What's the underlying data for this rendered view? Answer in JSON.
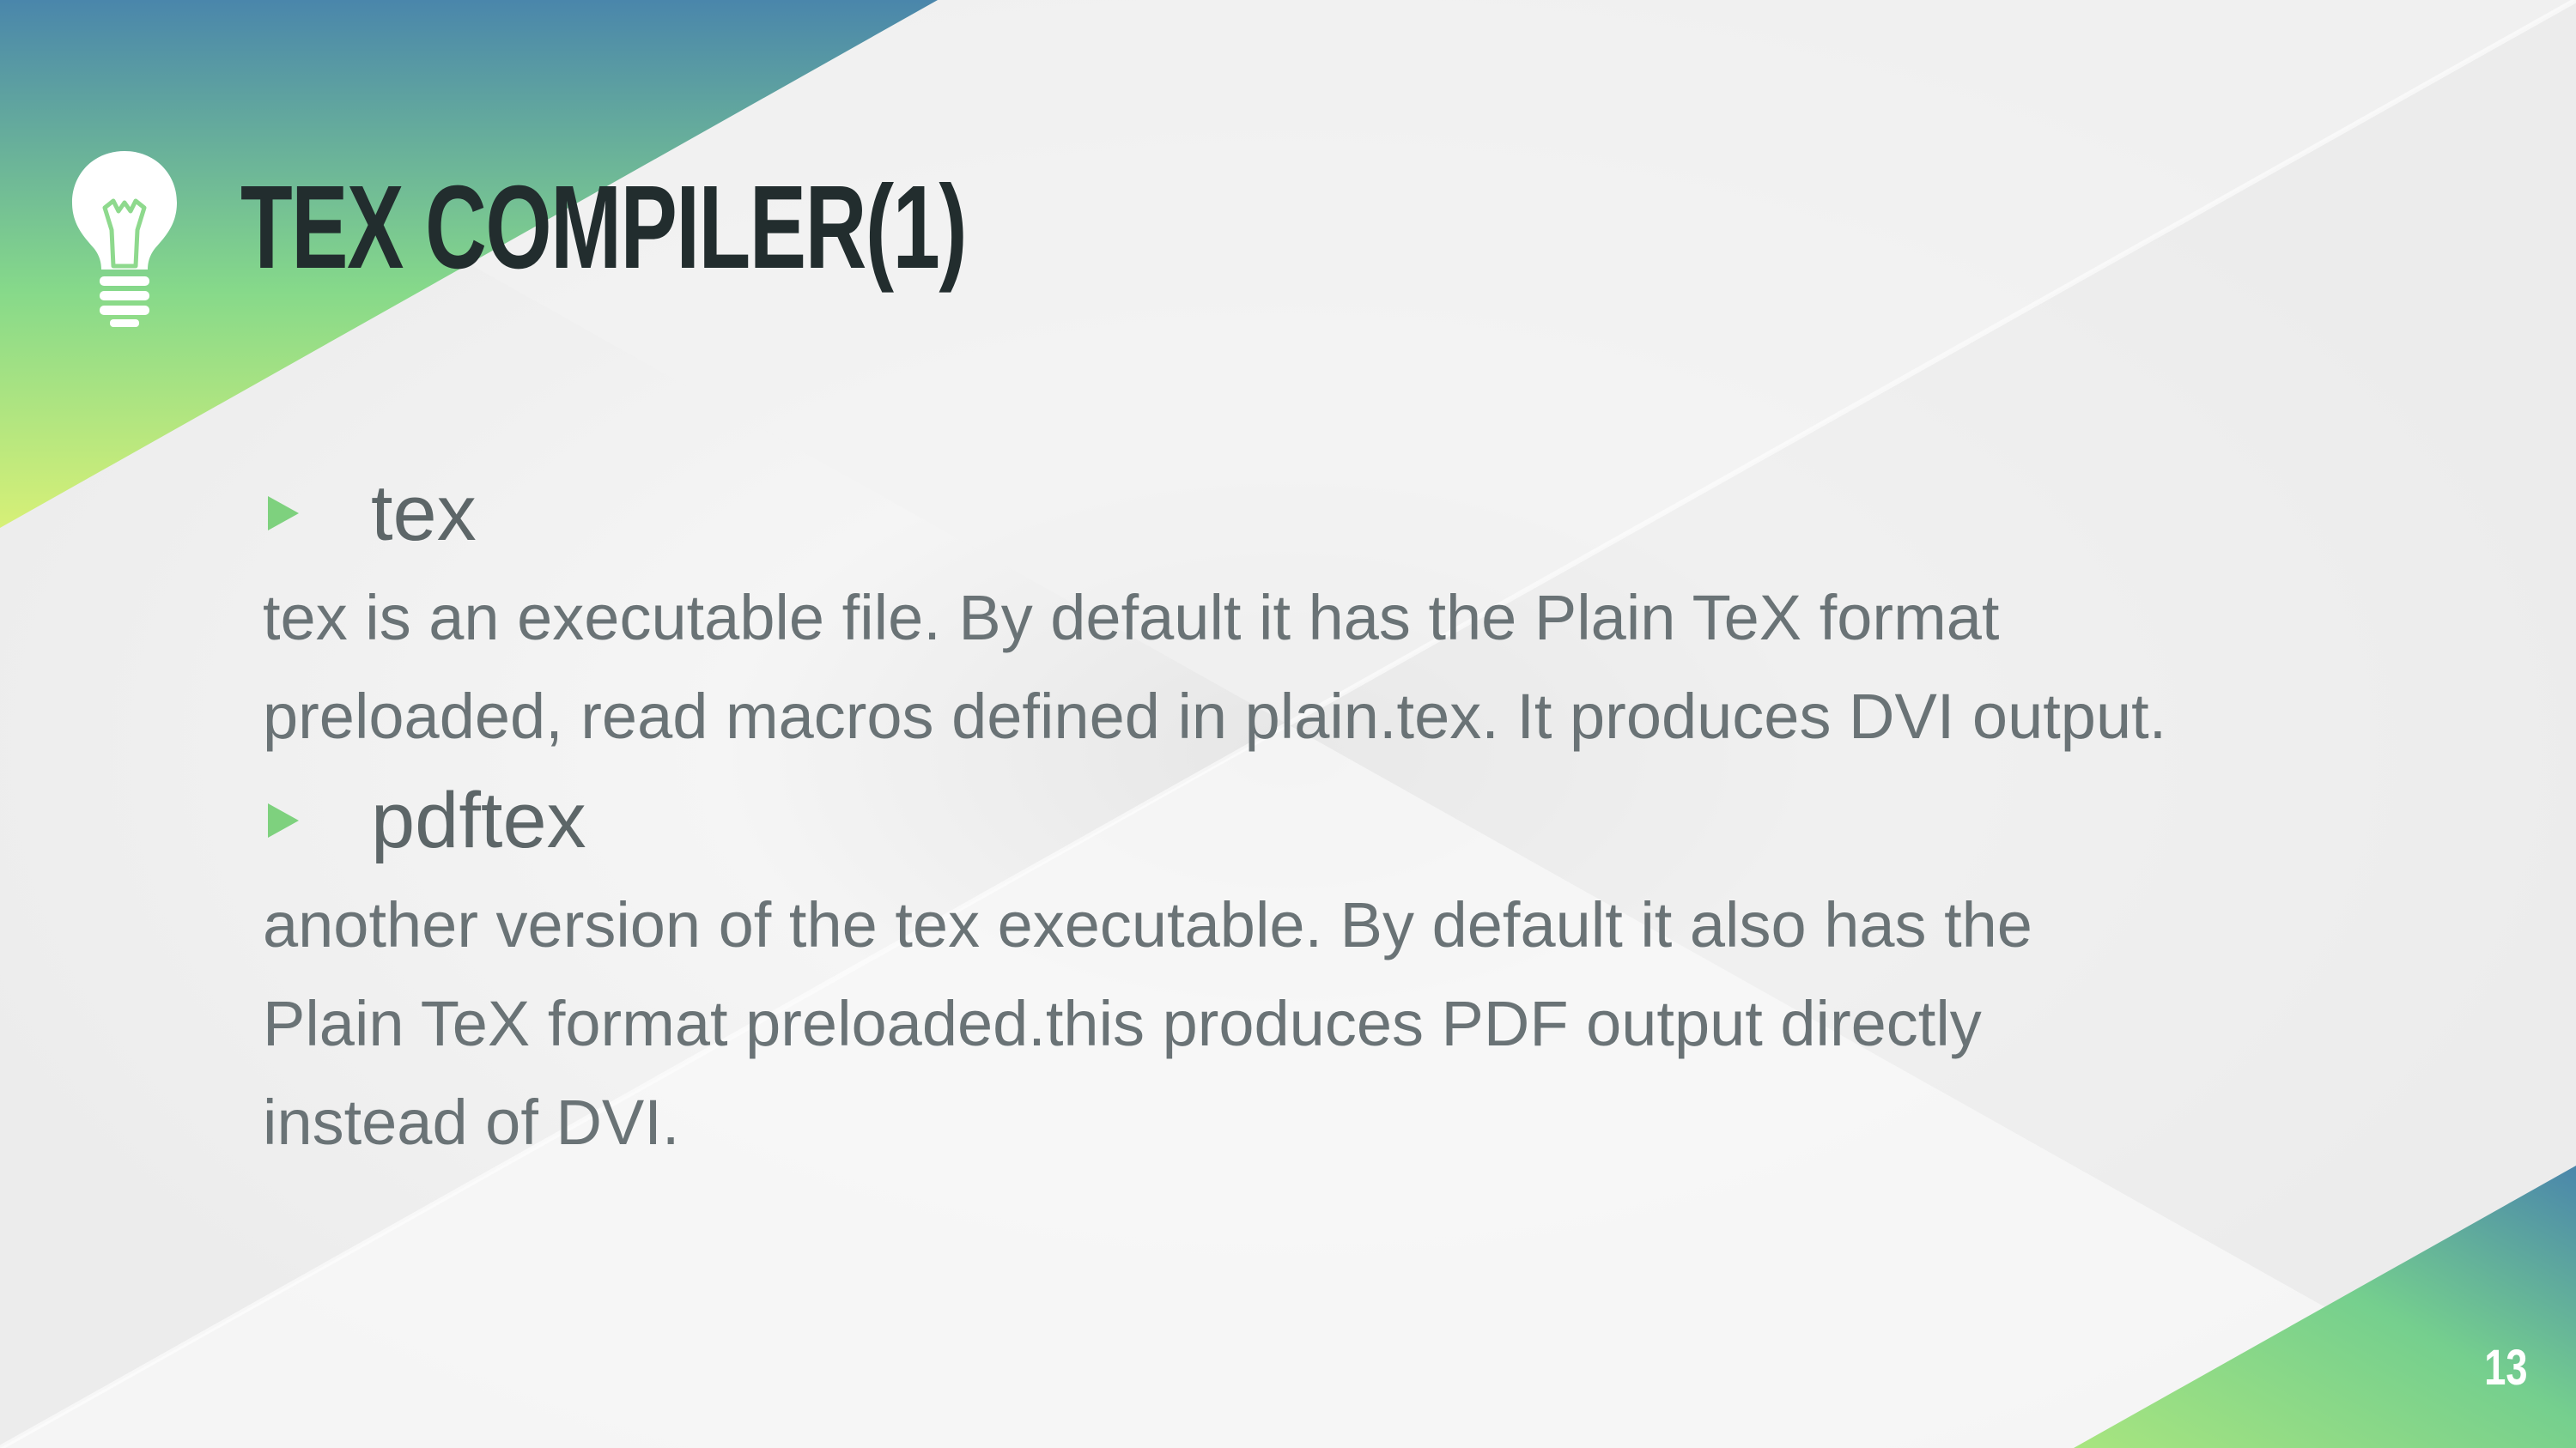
{
  "slide": {
    "title": "TEX COMPILER(1)",
    "page_number": "13",
    "bullets": [
      {
        "title": "tex",
        "description_lines": [
          "tex is an executable file. By default it has the Plain TeX format",
          "preloaded, read macros defined in plain.tex. It produces DVI output."
        ]
      },
      {
        "title": "pdftex",
        "description_lines": [
          "another version of the tex executable. By default it also has the",
          "Plain TeX format preloaded.this produces PDF output directly",
          "instead of DVI."
        ]
      }
    ],
    "icons": {
      "title_icon": "lightbulb-icon",
      "bullet_icon": "triangle-bullet-icon"
    },
    "colors": {
      "gradient_top": "#4a86ab",
      "gradient_mid": "#7ed38a",
      "gradient_bottom": "#d5ee76",
      "title": "#222d2e",
      "bullet_arrow": "#7ed17e",
      "text": "#6a7376"
    }
  }
}
